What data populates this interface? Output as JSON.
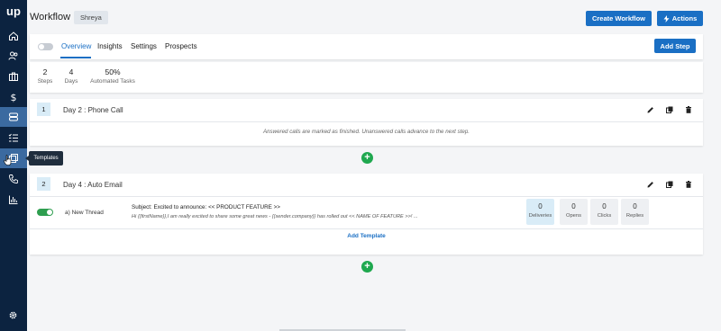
{
  "app": {
    "logo_text": "up"
  },
  "sidebar": {
    "items": [
      {
        "icon": "home-icon"
      },
      {
        "icon": "users-icon"
      },
      {
        "icon": "briefcase-icon"
      },
      {
        "icon": "dollar-icon"
      },
      {
        "icon": "workflow-icon"
      },
      {
        "icon": "list-icon"
      },
      {
        "icon": "templates-icon"
      },
      {
        "icon": "phone-icon"
      },
      {
        "icon": "analytics-icon"
      }
    ],
    "tooltip": "Templates",
    "settings_icon": "gear-icon"
  },
  "header": {
    "title": "Workflow",
    "owner": "Shreya",
    "create_button": "Create Workflow",
    "actions_button": "Actions"
  },
  "tabs": {
    "items": [
      "Overview",
      "Insights",
      "Settings",
      "Prospects"
    ],
    "active": "Overview",
    "add_step_button": "Add Step"
  },
  "stats": [
    {
      "value": "2",
      "label": "Steps"
    },
    {
      "value": "4",
      "label": "Days"
    },
    {
      "value": "50%",
      "label": "Automated Tasks"
    }
  ],
  "steps": [
    {
      "number": "1",
      "title": "Day 2 : Phone Call",
      "note": "Answered calls are marked as finished. Unanswered calls advance to the next step."
    },
    {
      "number": "2",
      "title": "Day 4 : Auto Email",
      "thread_label": "a) New Thread",
      "subject": "Subject: Excited to announce: << PRODUCT FEATURE >>",
      "preview": "Hi {{firstName}},I am really excited to share some great news - {{sender.company}} has rolled out << NAME OF FEATURE >>! ...",
      "metrics": [
        {
          "value": "0",
          "label": "Deliveries"
        },
        {
          "value": "0",
          "label": "Opens"
        },
        {
          "value": "0",
          "label": "Clicks"
        },
        {
          "value": "0",
          "label": "Replies"
        }
      ],
      "add_template": "Add Template"
    }
  ],
  "add_icon": "+",
  "colors": {
    "sidebar": "#0c2340",
    "primary": "#1a6fc4",
    "success": "#1fa84f"
  }
}
